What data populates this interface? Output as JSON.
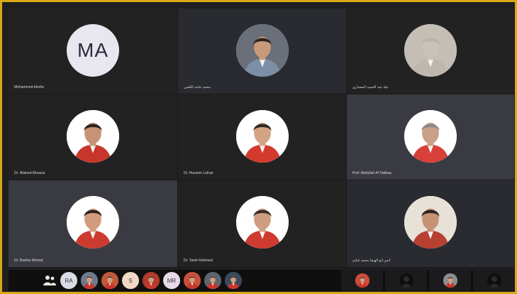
{
  "participants": [
    {
      "label": "Mohammed Alrefai",
      "initials": "MA",
      "type": "initials"
    },
    {
      "label": "محمد حامد الكعبي",
      "type": "photo",
      "bg": "#6a6f7a",
      "shirt": "#7b8fa6",
      "skin": "#c99a7a",
      "hair": "#2a2420"
    },
    {
      "label": "نيلة عبد الحميد المعماري",
      "type": "photo",
      "bg": "#c4beb5",
      "shirt": "#bdb7ad",
      "skin": "#c9c2b8",
      "hair": "#bab3a8"
    },
    {
      "label": "Dr. Waleed Moussa",
      "type": "photo",
      "bg": "#ffffff",
      "shirt": "#c8362b",
      "skin": "#c89276",
      "hair": "#2b2522"
    },
    {
      "label": "Dr. Hussein Lahrar",
      "type": "photo",
      "bg": "#ffffff",
      "shirt": "#d33a2d",
      "skin": "#d4a384",
      "hair": "#2e2824"
    },
    {
      "label": "Prof. Abdullah Al-Tabbaa",
      "type": "photo",
      "bg": "#ffffff",
      "shirt": "#d8413a",
      "skin": "#caa089",
      "hair": "#8c8a88"
    },
    {
      "label": "Dr. Bashar Ahmad",
      "type": "photo",
      "bg": "#ffffff",
      "shirt": "#cc3a30",
      "skin": "#d29c7c",
      "hair": "#2e2420"
    },
    {
      "label": "Dr. Tarek Rahmoul",
      "type": "photo",
      "bg": "#ffffff",
      "shirt": "#cf3b30",
      "skin": "#cf9d80",
      "hair": "#3b2e27"
    },
    {
      "label": "أنس أبو الهيجا محمد غنايم",
      "type": "photo",
      "bg": "#e7e1d8",
      "shirt": "#b74031",
      "skin": "#c79175",
      "hair": "#2a221f"
    }
  ],
  "overflow_bar": {
    "items": [
      {
        "kind": "icon",
        "name": "people-icon"
      },
      {
        "kind": "initials",
        "text": "RA",
        "bg": "#d9dce4"
      },
      {
        "kind": "photo",
        "bg": "#6e7a8c"
      },
      {
        "kind": "photo",
        "bg": "#c25a3a"
      },
      {
        "kind": "initials",
        "text": "S",
        "bg": "#f1d7c4"
      },
      {
        "kind": "photo",
        "bg": "#b33a2c"
      },
      {
        "kind": "initials",
        "text": "MR",
        "bg": "#e8d8e8"
      },
      {
        "kind": "photo",
        "bg": "#c9503c"
      },
      {
        "kind": "photo",
        "bg": "#5d6470"
      },
      {
        "kind": "photo",
        "bg": "#3a4a5c"
      }
    ],
    "slots": [
      {
        "bg": "#d14a3a"
      },
      {
        "bg": "#1b1b1b"
      },
      {
        "bg": "#8b8e8f"
      },
      {
        "bg": "#1b1b1b"
      }
    ]
  }
}
